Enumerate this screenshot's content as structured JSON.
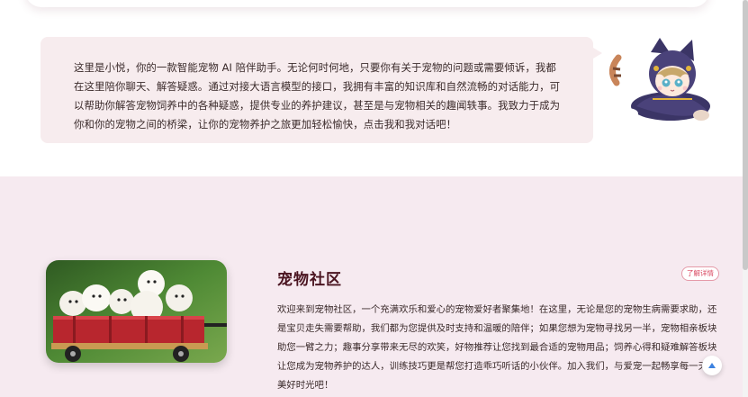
{
  "intro": {
    "text": "这里是小悦，你的一款智能宠物 AI 陪伴助手。无论何时何地，只要你有关于宠物的问题或需要倾诉，我都在这里陪你聊天、解答疑惑。通过对接大语言模型的接口，我拥有丰富的知识库和自然流畅的对话能力，可以帮助你解答宠物饲养中的各种疑惑，提供专业的养护建议，甚至是与宠物相关的趣闻轶事。我致力于成为你和你的宠物之间的桥梁，让你的宠物养护之旅更加轻松愉快，点击我和我对话吧！",
    "mascot_icon": "anime-cat-girl-mascot"
  },
  "community": {
    "title": "宠物社区",
    "more_label": "了解详情",
    "description": "欢迎来到宠物社区，一个充满欢乐和爱心的宠物爱好者聚集地！在这里，无论是您的宠物生病需要求助，还是宝贝走失需要帮助，我们都为您提供及时支持和温暖的陪伴；如果您想为宠物寻找另一半，宠物相亲板块助您一臂之力；趣事分享带来无尽的欢笑，好物推荐让您找到最合适的宠物用品；饲养心得和疑难解答板块让您成为宠物养护的达人，训练技巧更是帮您打造乖巧听话的小伙伴。加入我们，与爱宠一起畅享每一天的美好时光吧！",
    "image_icon": "puppies-in-red-wagon-photo"
  },
  "ui": {
    "back_to_top_icon": "arrow-up-icon",
    "accent": "#d9455e",
    "bubble_bg": "#f7ecee",
    "section_bg": "#f6eaf0"
  }
}
